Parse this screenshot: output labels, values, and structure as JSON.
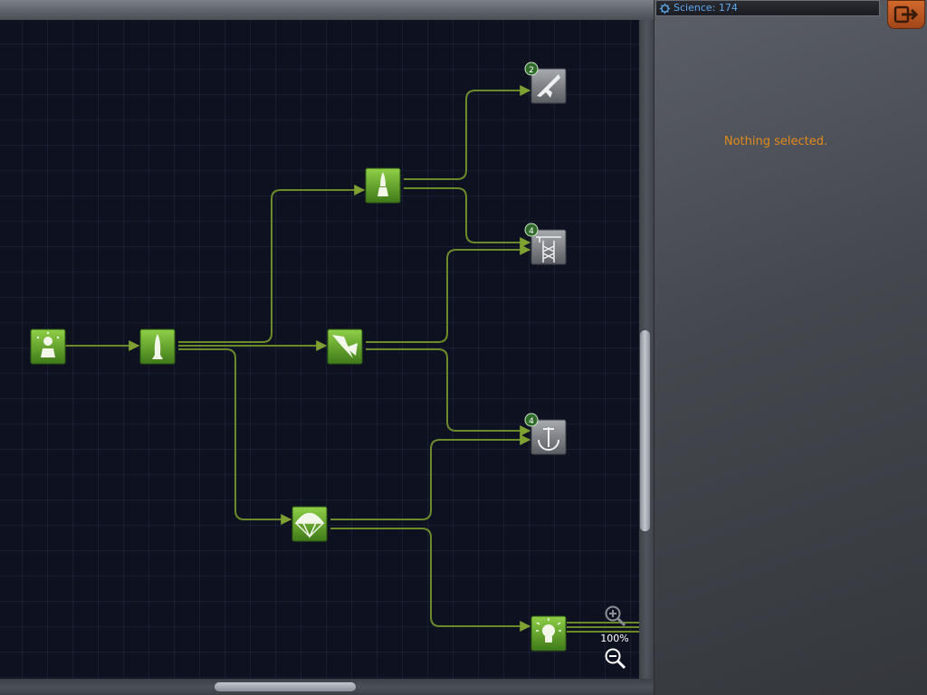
{
  "header": {
    "science_label": "Science: 174"
  },
  "panel": {
    "status_text": "Nothing selected."
  },
  "zoom": {
    "level_label": "100%"
  },
  "tech_nodes": [
    {
      "id": "start",
      "icon": "astronaut-icon",
      "state": "researched"
    },
    {
      "id": "basic-rocketry",
      "icon": "rocket-icon",
      "state": "researched"
    },
    {
      "id": "general-rocketry",
      "icon": "rocket-engine-icon",
      "state": "researched"
    },
    {
      "id": "engineering",
      "icon": "fins-icon",
      "state": "researched"
    },
    {
      "id": "survivability",
      "icon": "parachute-icon",
      "state": "researched"
    },
    {
      "id": "basic-science",
      "icon": "lightbulb-icon",
      "state": "researched"
    },
    {
      "id": "advanced-rocketry",
      "icon": "spaceplane-icon",
      "state": "locked",
      "badge": "2"
    },
    {
      "id": "general-construction",
      "icon": "launch-tower-icon",
      "state": "locked",
      "badge": "4"
    },
    {
      "id": "stability",
      "icon": "gyroscope-icon",
      "state": "locked",
      "badge": "4"
    }
  ],
  "colors": {
    "researched_node": "#62a42c",
    "locked_node": "#7d8085",
    "connector": "#6b8a2a",
    "science_text": "#5ea8ee",
    "status_text": "#e48a1a",
    "exit_button": "#c45a22"
  }
}
